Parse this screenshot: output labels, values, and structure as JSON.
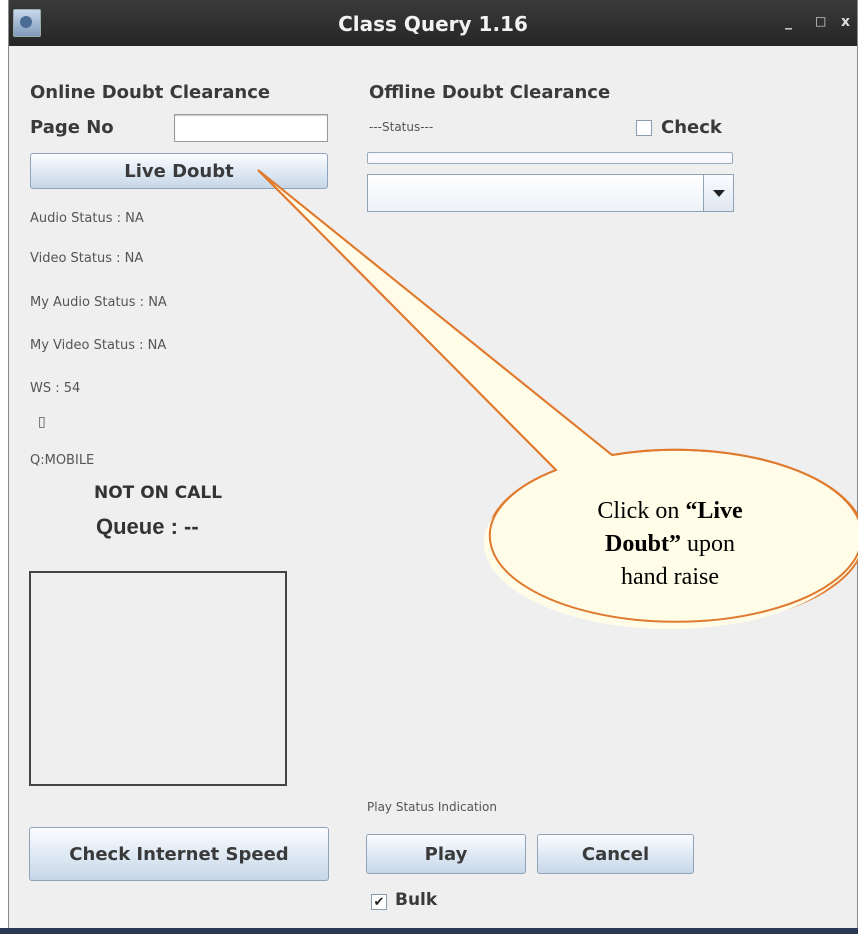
{
  "window": {
    "title": "Class Query 1.16",
    "controls": {
      "minimize": "_",
      "maximize": "□",
      "close": "x"
    }
  },
  "online": {
    "heading": "Online Doubt Clearance",
    "page_no_label": "Page No",
    "page_no_value": "",
    "live_doubt_label": "Live Doubt",
    "audio_status": "Audio Status : NA",
    "video_status": "Video Status : NA",
    "my_audio_status": "My Audio Status : NA",
    "my_video_status": "My Video Status : NA",
    "ws": "WS : 54",
    "ws_glyph": "▯",
    "q_mobile": "Q:MOBILE",
    "call_status": "NOT ON CALL",
    "queue": "Queue : --",
    "check_speed_label": "Check Internet Speed"
  },
  "offline": {
    "heading": "Offline Doubt Clearance",
    "status": "---Status---",
    "check_label": "Check",
    "check_checked": false,
    "progress": 0,
    "combo_value": "",
    "play_status": "Play Status Indication",
    "play_label": "Play",
    "cancel_label": "Cancel",
    "bulk_label": "Bulk",
    "bulk_checked": true,
    "bulk_mark": "✔"
  },
  "callout": {
    "line1": "Click on ",
    "bold1": "“Live",
    "bold2": "Doubt”",
    "line2_rest": " upon",
    "line3": "hand raise",
    "fill": "#fffde8",
    "stroke": "#e07a2e"
  }
}
